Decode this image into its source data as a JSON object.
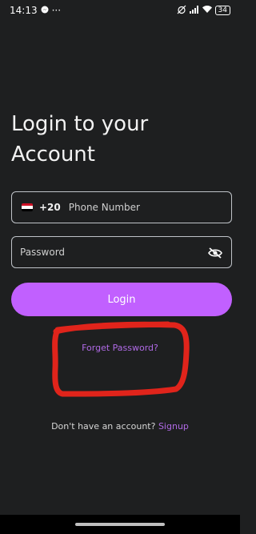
{
  "status_bar": {
    "time": "14:13",
    "more": "···",
    "battery": "34"
  },
  "title": {
    "line1": "Login to your",
    "line2": "Account"
  },
  "phone": {
    "country_code": "+20",
    "placeholder": "Phone Number",
    "flag": "egypt-flag"
  },
  "password": {
    "placeholder": "Password",
    "toggle_icon": "eye-off-icon"
  },
  "login_button": {
    "label": "Login",
    "color": "#c160ff"
  },
  "forget_password": {
    "label": "Forget Password?",
    "color": "#b06ae6"
  },
  "signup": {
    "prompt": "Don't have an account?",
    "link": "Signup"
  },
  "annotation": {
    "color": "#e0241b"
  }
}
